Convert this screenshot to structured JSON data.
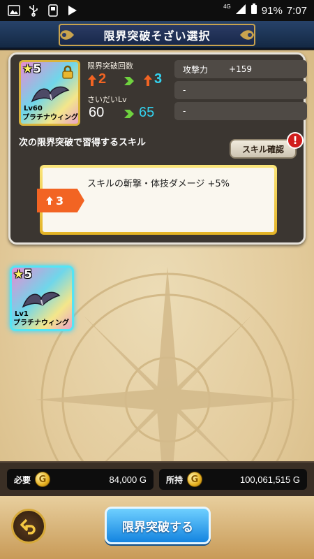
{
  "status_bar": {
    "network": "4G",
    "battery": "91%",
    "time": "7:07",
    "icons": [
      "image-icon",
      "usb-icon",
      "notification-icon",
      "play-store-icon",
      "signal-icon",
      "battery-icon"
    ]
  },
  "header": {
    "title": "限界突破そざい選択"
  },
  "target_item": {
    "stars": "5",
    "level": "Lv60",
    "name": "プラチナウィング",
    "locked": true
  },
  "limit_break": {
    "count_label": "限界突破回数",
    "count_from": "2",
    "count_to": "3",
    "max_lv_label": "さいだいLv",
    "lv_from": "60",
    "lv_to": "65"
  },
  "stats": [
    {
      "name": "攻撃力",
      "value": "+159"
    },
    {
      "name": "-",
      "value": ""
    },
    {
      "name": "-",
      "value": ""
    }
  ],
  "skill_section": {
    "heading": "次の限界突破で習得するスキル",
    "confirm_button": "スキル確認",
    "badge": "!",
    "skill_text": "スキルの斬撃・体技ダメージ +5%",
    "tag_level": "3"
  },
  "material_item": {
    "stars": "5",
    "level": "Lv1",
    "name": "プラチナウィング",
    "selected": true
  },
  "gold": {
    "required_label": "必要",
    "required_amount": "84,000 G",
    "owned_label": "所持",
    "owned_amount": "100,061,515 G",
    "coin_glyph": "G"
  },
  "footer": {
    "action_button": "限界突破する"
  },
  "colors": {
    "accent_orange": "#f26423",
    "accent_cyan": "#33d3f0",
    "accent_green": "#6fd23f",
    "button_blue": "#1484e0"
  }
}
